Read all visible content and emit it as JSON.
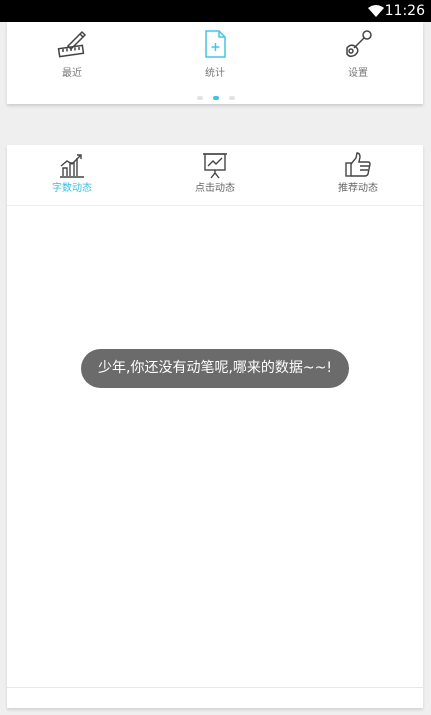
{
  "status_bar": {
    "time": "11:26",
    "icons": [
      "wifi-icon"
    ]
  },
  "top_nav": {
    "items": [
      {
        "label": "最近",
        "icon": "edit-ruler-icon",
        "active": false
      },
      {
        "label": "统计",
        "icon": "document-add-icon",
        "active": true
      },
      {
        "label": "设置",
        "icon": "wrench-icon",
        "active": false
      }
    ],
    "pager": {
      "pages": 3,
      "current": 2
    },
    "accent_color": "#45c3e6"
  },
  "tabs": [
    {
      "label": "字数动态",
      "icon": "bar-chart-icon",
      "active": true
    },
    {
      "label": "点击动态",
      "icon": "presentation-chart-icon",
      "active": false
    },
    {
      "label": "推荐动态",
      "icon": "thumbs-up-icon",
      "active": false
    }
  ],
  "toast": {
    "message": "少年,你还没有动笔呢,哪来的数据~~!"
  },
  "colors": {
    "active_tab_text": "#3bbde3",
    "background": "#efefef",
    "toast_bg": "#6b6b6b"
  }
}
